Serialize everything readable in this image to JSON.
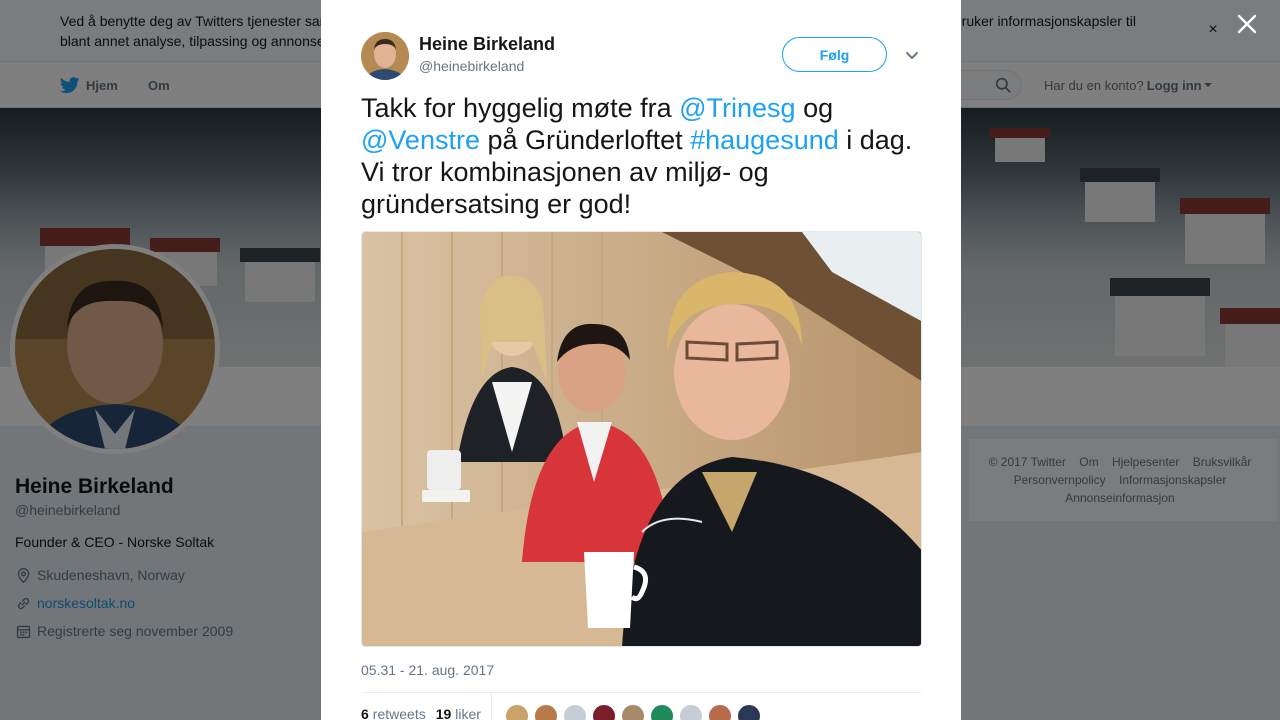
{
  "cookie_bar": {
    "text": "Ved å benytte deg av Twitters tjenester samtykker du i at vi bruker informasjonskapsler og at vi og våre samarbeidspartnere opererer globalt, og bruker informasjonskapsler til blant annet analyse, tilpassing og annonser.",
    "close_label": "×"
  },
  "nav": {
    "home_label": "Hjem",
    "about_label": "Om",
    "account_prompt": "Har du en konto?",
    "login_label": "Logg inn"
  },
  "profile": {
    "name": "Heine Birkeland",
    "handle": "@heinebirkeland",
    "bio": "Founder & CEO - Norske Soltak",
    "location": "Skudeneshavn, Norway",
    "website": "norskesoltak.no",
    "joined": "Registrerte seg november 2009"
  },
  "footer": {
    "links": [
      "© 2017 Twitter",
      "Om",
      "Hjelpesenter",
      "Bruksvilkår",
      "Personvernpolicy",
      "Informasjonskapsler",
      "Annonseinformasjon"
    ]
  },
  "tweet": {
    "author_name": "Heine Birkeland",
    "author_handle": "@heinebirkeland",
    "follow_label": "Følg",
    "text_parts": {
      "p1": "Takk for hyggelig møte fra ",
      "mention1": "@Trinesg",
      "p2": " og ",
      "mention2": "@Venstre",
      "p3": " på Gründerloftet ",
      "hashtag": "#haugesund",
      "p4": " i dag. Vi tror kombinasjonen av miljø- og gründersatsing er god!"
    },
    "timestamp": "05.31 - 21. aug. 2017",
    "retweets_count": "6",
    "retweets_label": "retweets",
    "likes_count": "19",
    "likes_label": "liker",
    "liker_colors": [
      "#c9a36b",
      "#b97a4a",
      "#c5ced6",
      "#7a1f2a",
      "#a88a6a",
      "#1f8a5a",
      "#c5ced6",
      "#b86a4a",
      "#2a3a55"
    ]
  },
  "colors": {
    "accent": "#1da1f2",
    "link": "#1b95e0",
    "overlay": "rgba(0,0,0,0.5)"
  },
  "icons": [
    "twitter-bird-icon",
    "search-icon",
    "location-icon",
    "link-icon",
    "calendar-icon",
    "close-icon",
    "chevron-down-icon"
  ]
}
